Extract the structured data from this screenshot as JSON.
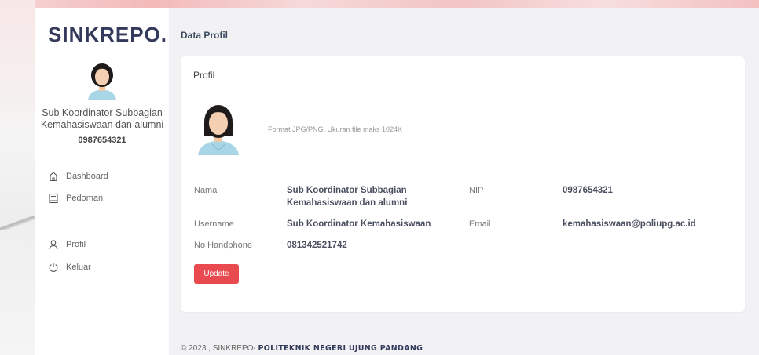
{
  "brand": "SINKREPO.",
  "page_title": "Data Profil",
  "sidebar": {
    "role": "Sub Koordinator Subbagian Kemahasiswaan dan alumni",
    "nip": "0987654321",
    "items": [
      {
        "label": "Dashboard",
        "icon": "home-icon"
      },
      {
        "label": "Pedoman",
        "icon": "book-icon"
      },
      {
        "label": "Profil",
        "icon": "user-icon"
      },
      {
        "label": "Keluar",
        "icon": "power-icon"
      }
    ]
  },
  "card": {
    "title": "Profil",
    "format_note": "Format JPG/PNG. Ukuran file maks 1024K",
    "fields": {
      "nama_label": "Nama",
      "nama_value": "Sub Koordinator Subbagian Kemahasiswaan dan alumni",
      "nip_label": "NIP",
      "nip_value": "0987654321",
      "username_label": "Username",
      "username_value": "Sub Koordinator Kemahasiswaan",
      "email_label": "Email",
      "email_value": "kemahasiswaan@poliupg.ac.id",
      "hp_label": "No Handphone",
      "hp_value": "081342521742"
    },
    "update_label": "Update"
  },
  "footer": {
    "prefix": "© 2023 , SINKREPO- ",
    "org": "POLITEKNIK NEGERI UJUNG PANDANG"
  },
  "colors": {
    "brand": "#333a5c",
    "button": "#e84a4f",
    "background": "#f2f2f5"
  }
}
